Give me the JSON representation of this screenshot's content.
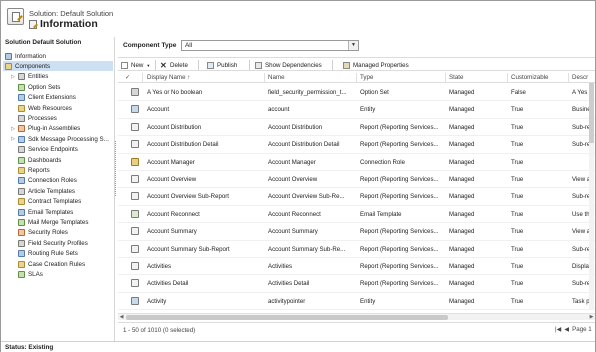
{
  "header": {
    "solution_label": "Solution: Default Solution",
    "title": "Information",
    "icon": "solution-icon"
  },
  "sidebar": {
    "title": "Solution Default Solution",
    "items": [
      {
        "label": "Information",
        "icon": "information-icon",
        "expander": false,
        "selected": false
      },
      {
        "label": "Components",
        "icon": "components-icon",
        "expander": false,
        "selected": true
      },
      {
        "label": "Entities",
        "icon": "entities-icon",
        "expander": true,
        "selected": false
      },
      {
        "label": "Option Sets",
        "icon": "option-sets-icon",
        "expander": false,
        "selected": false
      },
      {
        "label": "Client Extensions",
        "icon": "client-extensions-icon",
        "expander": false,
        "selected": false
      },
      {
        "label": "Web Resources",
        "icon": "web-resources-icon",
        "expander": false,
        "selected": false
      },
      {
        "label": "Processes",
        "icon": "processes-icon",
        "expander": false,
        "selected": false
      },
      {
        "label": "Plug-in Assemblies",
        "icon": "plugin-assemblies-icon",
        "expander": true,
        "selected": false
      },
      {
        "label": "Sdk Message Processing S...",
        "icon": "sdk-message-icon",
        "expander": true,
        "selected": false
      },
      {
        "label": "Service Endpoints",
        "icon": "service-endpoints-icon",
        "expander": false,
        "selected": false
      },
      {
        "label": "Dashboards",
        "icon": "dashboards-icon",
        "expander": false,
        "selected": false
      },
      {
        "label": "Reports",
        "icon": "reports-icon",
        "expander": false,
        "selected": false
      },
      {
        "label": "Connection Roles",
        "icon": "connection-roles-icon",
        "expander": false,
        "selected": false
      },
      {
        "label": "Article Templates",
        "icon": "article-templates-icon",
        "expander": false,
        "selected": false
      },
      {
        "label": "Contract Templates",
        "icon": "contract-templates-icon",
        "expander": false,
        "selected": false
      },
      {
        "label": "Email Templates",
        "icon": "email-templates-icon",
        "expander": false,
        "selected": false
      },
      {
        "label": "Mail Merge Templates",
        "icon": "mail-merge-templates-icon",
        "expander": false,
        "selected": false
      },
      {
        "label": "Security Roles",
        "icon": "security-roles-icon",
        "expander": false,
        "selected": false
      },
      {
        "label": "Field Security Profiles",
        "icon": "field-security-profiles-icon",
        "expander": false,
        "selected": false
      },
      {
        "label": "Routing Rule Sets",
        "icon": "routing-rule-sets-icon",
        "expander": false,
        "selected": false
      },
      {
        "label": "Case Creation Rules",
        "icon": "case-creation-rules-icon",
        "expander": false,
        "selected": false
      },
      {
        "label": "SLAs",
        "icon": "slas-icon",
        "expander": false,
        "selected": false
      }
    ]
  },
  "filter": {
    "label": "Component Type",
    "value": "All"
  },
  "toolbar": {
    "new_label": "New",
    "delete_label": "Delete",
    "publish_label": "Publish",
    "show_dependencies_label": "Show Dependencies",
    "managed_properties_label": "Managed Properties"
  },
  "grid": {
    "columns": [
      "Display Name",
      "Name",
      "Type",
      "State",
      "Customizable",
      "Descr"
    ],
    "sort_indicator": "↑",
    "rows": [
      {
        "icon": "option-set-icon",
        "display_name": "A Yes or No boolean",
        "name": "field_security_permission_t...",
        "type": "Option Set",
        "state": "Managed",
        "customizable": "False",
        "description": "A Yes o"
      },
      {
        "icon": "entity-icon",
        "display_name": "Account",
        "name": "account",
        "type": "Entity",
        "state": "Managed",
        "customizable": "True",
        "description": "Busines"
      },
      {
        "icon": "report-icon",
        "display_name": "Account Distribution",
        "name": "Account Distribution",
        "type": "Report (Reporting Services...",
        "state": "Managed",
        "customizable": "True",
        "description": "Sub-rep"
      },
      {
        "icon": "report-icon",
        "display_name": "Account Distribution Detail",
        "name": "Account Distribution Detail",
        "type": "Report (Reporting Services...",
        "state": "Managed",
        "customizable": "True",
        "description": "Sub-rep"
      },
      {
        "icon": "connection-role-icon",
        "display_name": "Account Manager",
        "name": "Account Manager",
        "type": "Connection Role",
        "state": "Managed",
        "customizable": "True",
        "description": ""
      },
      {
        "icon": "report-icon",
        "display_name": "Account Overview",
        "name": "Account Overview",
        "type": "Report (Reporting Services...",
        "state": "Managed",
        "customizable": "True",
        "description": "View a"
      },
      {
        "icon": "report-icon",
        "display_name": "Account Overview Sub-Report",
        "name": "Account Overview Sub-Re...",
        "type": "Report (Reporting Services...",
        "state": "Managed",
        "customizable": "True",
        "description": "Sub-rep"
      },
      {
        "icon": "email-template-icon",
        "display_name": "Account Reconnect",
        "name": "Account Reconnect",
        "type": "Email Template",
        "state": "Managed",
        "customizable": "True",
        "description": "Use this"
      },
      {
        "icon": "report-icon",
        "display_name": "Account Summary",
        "name": "Account Summary",
        "type": "Report (Reporting Services...",
        "state": "Managed",
        "customizable": "True",
        "description": "View a"
      },
      {
        "icon": "report-icon",
        "display_name": "Account Summary Sub-Report",
        "name": "Account Summary Sub-Re...",
        "type": "Report (Reporting Services...",
        "state": "Managed",
        "customizable": "True",
        "description": "Sub-rep"
      },
      {
        "icon": "report-icon",
        "display_name": "Activities",
        "name": "Activities",
        "type": "Report (Reporting Services...",
        "state": "Managed",
        "customizable": "True",
        "description": "Display"
      },
      {
        "icon": "report-icon",
        "display_name": "Activities Detail",
        "name": "Activities Detail",
        "type": "Report (Reporting Services...",
        "state": "Managed",
        "customizable": "True",
        "description": "Sub-rep"
      },
      {
        "icon": "entity-icon",
        "display_name": "Activity",
        "name": "activitypointer",
        "type": "Entity",
        "state": "Managed",
        "customizable": "True",
        "description": "Task pe"
      }
    ]
  },
  "footer": {
    "count": "1 - 50 of 1010 (0 selected)",
    "page": "Page 1"
  },
  "status": {
    "text": "Status: Existing"
  }
}
